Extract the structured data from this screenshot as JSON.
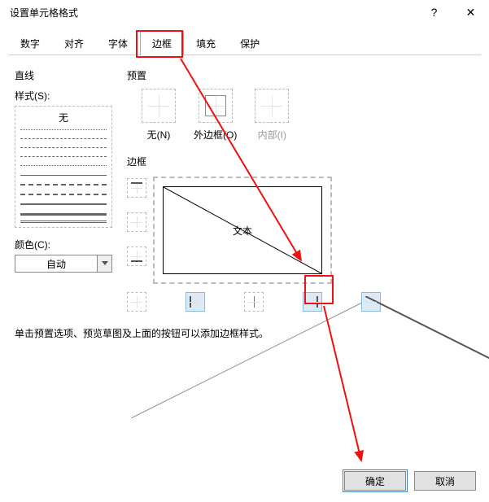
{
  "window": {
    "title": "设置单元格格式"
  },
  "tabs": [
    "数字",
    "对齐",
    "字体",
    "边框",
    "填充",
    "保护"
  ],
  "active_tab": "边框",
  "left": {
    "line_section": "直线",
    "style_label": "样式(S):",
    "none_text": "无",
    "color_label": "颜色(C):",
    "color_value": "自动"
  },
  "right": {
    "preset_section": "预置",
    "presets": {
      "none": "无(N)",
      "outline": "外边框(O)",
      "inside": "内部(I)"
    },
    "border_section": "边框",
    "preview_text": "文本"
  },
  "hint": "单击预置选项、预览草图及上面的按钮可以添加边框样式。",
  "buttons": {
    "ok": "确定",
    "cancel": "取消"
  }
}
